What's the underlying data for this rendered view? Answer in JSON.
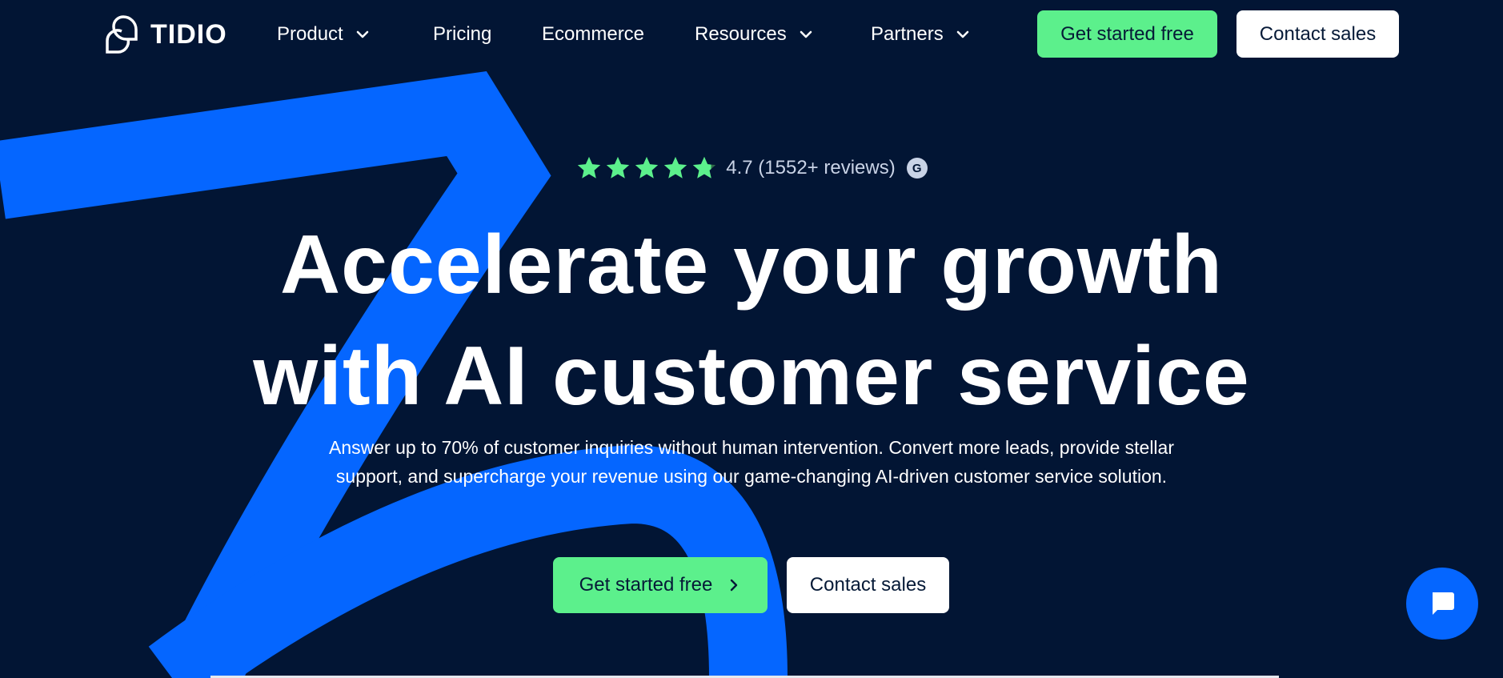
{
  "brand": {
    "name": "TIDIO",
    "logo_icon": "tidio-logo-icon",
    "bg_color": "#021534",
    "accent_green": "#5cf08c",
    "accent_blue": "#0566ff"
  },
  "nav": {
    "items": [
      {
        "label": "Product",
        "has_dropdown": true
      },
      {
        "label": "Pricing",
        "has_dropdown": false
      },
      {
        "label": "Ecommerce",
        "has_dropdown": false
      },
      {
        "label": "Resources",
        "has_dropdown": true
      },
      {
        "label": "Partners",
        "has_dropdown": true
      }
    ],
    "primary_cta": "Get started free",
    "secondary_cta": "Contact sales"
  },
  "hero": {
    "rating": {
      "stars": 4.7,
      "max_stars": 5,
      "text": "4.7 (1552+ reviews)",
      "badge_icon": "g2-icon",
      "badge_letter": "G"
    },
    "headline": {
      "line1": "Accelerate your growth",
      "line2": "with AI customer service"
    },
    "subtext": {
      "line1": "Answer up to 70% of customer inquiries without human intervention. Convert more leads, provide stellar",
      "line2": "support, and supercharge your revenue using our game-changing AI-driven customer service solution."
    },
    "primary_cta": "Get started free",
    "secondary_cta": "Contact sales"
  },
  "chat_widget": {
    "icon": "chat-bubble-icon"
  }
}
